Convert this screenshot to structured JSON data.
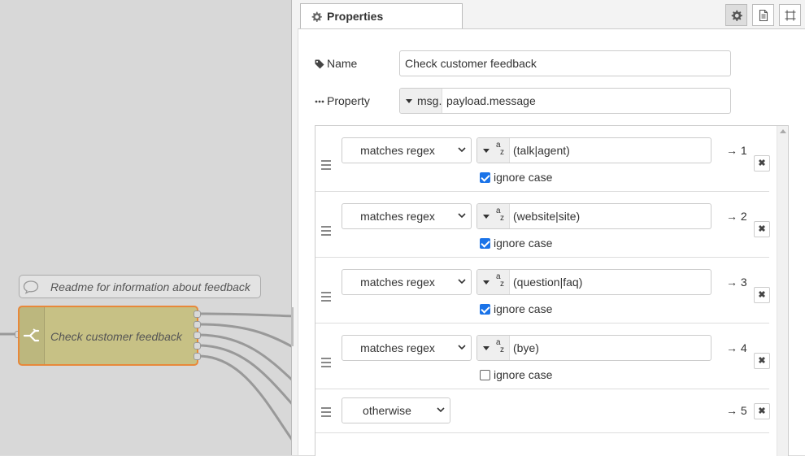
{
  "canvas": {
    "comment_label": "Readme for information about feedback",
    "switch_label": "Check customer feedback"
  },
  "panel": {
    "tab_label": "Properties",
    "buttons": [
      "gear-icon",
      "description-icon",
      "appearance-icon"
    ],
    "name": {
      "label": "Name",
      "value": "Check customer feedback"
    },
    "property": {
      "label": "Property",
      "prefix": "msg.",
      "value": "payload.message"
    }
  },
  "rules": [
    {
      "operator": "matches regex",
      "type_glyph_a": "a",
      "type_glyph_z": "z",
      "value": "(talk|agent)",
      "ignore_case": true,
      "ignore_case_label": "ignore case",
      "output": "→ 1",
      "delete_glyph": "✖"
    },
    {
      "operator": "matches regex",
      "type_glyph_a": "a",
      "type_glyph_z": "z",
      "value": "(website|site)",
      "ignore_case": true,
      "ignore_case_label": "ignore case",
      "output": "→ 2",
      "delete_glyph": "✖"
    },
    {
      "operator": "matches regex",
      "type_glyph_a": "a",
      "type_glyph_z": "z",
      "value": "(question|faq)",
      "ignore_case": true,
      "ignore_case_label": "ignore case",
      "output": "→ 3",
      "delete_glyph": "✖"
    },
    {
      "operator": "matches regex",
      "type_glyph_a": "a",
      "type_glyph_z": "z",
      "value": "(bye)",
      "ignore_case": false,
      "ignore_case_label": "ignore case",
      "output": "→ 4",
      "delete_glyph": "✖"
    },
    {
      "operator": "otherwise",
      "output": "→ 5",
      "delete_glyph": "✖"
    }
  ],
  "colors": {
    "switch_node_fill": "#c7c185",
    "switch_node_border": "#e8883a",
    "checkbox_checked": "#1a73e8"
  }
}
